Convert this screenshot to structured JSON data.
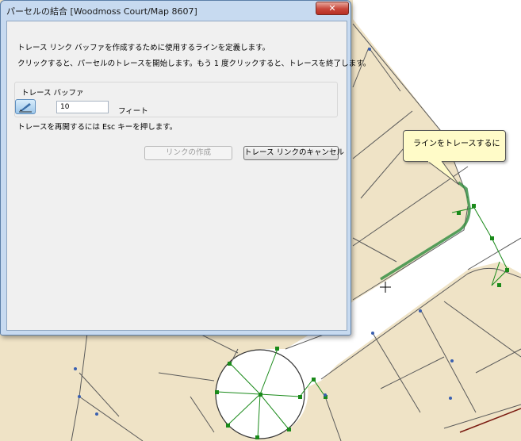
{
  "dialog": {
    "title": "パーセルの結合 [Woodmoss Court/Map 8607]",
    "close_label": "✕",
    "instruction_1": "トレース リンク バッファを作成するために使用するラインを定義します。",
    "instruction_2": "クリックすると、パーセルのトレースを開始します。もう 1 度クリックすると、トレースを終了します。",
    "buffer_group_label": "トレース バッファ",
    "buffer_value": "10",
    "buffer_unit": "フィート",
    "resume_hint": "トレースを再開するには  Esc  キーを押します。",
    "create_button": "リンクの作成",
    "cancel_button": "トレース リンクのキャンセル"
  },
  "tooltip": {
    "text": "ラインをトレースするに"
  },
  "colors": {
    "parcel_fill": "#efe3c6",
    "parcel_line": "#5a5a5a",
    "trace_highlight": "#2e8b3d",
    "vertex": "#1a8a1a",
    "node_blue": "#3a5fb0",
    "tooltip_bg": "#fffbc8",
    "dialog_frame": "#c7daf0"
  }
}
